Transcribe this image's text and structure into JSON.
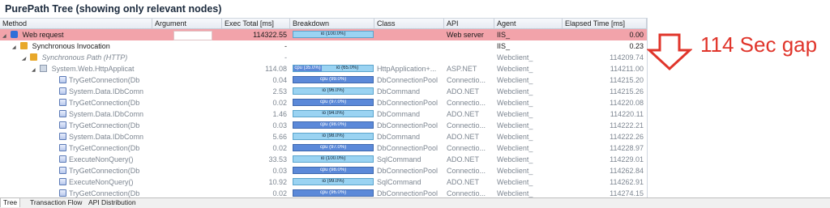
{
  "title": "PurePath Tree (showing only relevant nodes)",
  "columns": {
    "method": "Method",
    "argument": "Argument",
    "exec_total": "Exec Total [ms]",
    "breakdown": "Breakdown",
    "class": "Class",
    "api": "API",
    "agent": "Agent",
    "elapsed": "Elapsed Time [ms]"
  },
  "rows": [
    {
      "method": "Web request",
      "argument": "",
      "exec": "114322.55",
      "breakdown": "io (100.0%)",
      "class": "",
      "api": "Web server",
      "agent": "IIS_",
      "elapsed": "0.00"
    },
    {
      "method": "Synchronous Invocation",
      "argument": "",
      "exec": "-",
      "breakdown": "",
      "class": "",
      "api": "",
      "agent": "IIS_",
      "elapsed": "0.23"
    },
    {
      "method": "Synchronous Path (HTTP)",
      "argument": "",
      "exec": "-",
      "breakdown": "",
      "class": "",
      "api": "",
      "agent": "Webclient_",
      "elapsed": "114209.74"
    },
    {
      "method": "System.Web.HttpApplicat",
      "argument": "",
      "exec": "114.08",
      "breakdown_cpu": "cpu (35.0%)",
      "breakdown_io": "io (65.0%)",
      "class": "HttpApplication+...",
      "api": "ASP.NET",
      "agent": "Webclient_",
      "elapsed": "114211.00"
    },
    {
      "method": "TryGetConnection(Db",
      "argument": "",
      "exec": "0.04",
      "breakdown": "cpu (99.0%)",
      "class": "DbConnectionPool",
      "api": "Connectio...",
      "agent": "Webclient_",
      "elapsed": "114215.20"
    },
    {
      "method": "System.Data.IDbComn",
      "argument": "",
      "exec": "2.53",
      "breakdown": "io (96.0%)",
      "class": "DbCommand",
      "api": "ADO.NET",
      "agent": "Webclient_",
      "elapsed": "114215.26"
    },
    {
      "method": "TryGetConnection(Db",
      "argument": "",
      "exec": "0.02",
      "breakdown": "cpu (97.0%)",
      "class": "DbConnectionPool",
      "api": "Connectio...",
      "agent": "Webclient_",
      "elapsed": "114220.08"
    },
    {
      "method": "System.Data.IDbComn",
      "argument": "",
      "exec": "1.46",
      "breakdown": "io (94.0%)",
      "class": "DbCommand",
      "api": "ADO.NET",
      "agent": "Webclient_",
      "elapsed": "114220.11"
    },
    {
      "method": "TryGetConnection(Db",
      "argument": "",
      "exec": "0.03",
      "breakdown": "cpu (98.0%)",
      "class": "DbConnectionPool",
      "api": "Connectio...",
      "agent": "Webclient_",
      "elapsed": "114222.21"
    },
    {
      "method": "System.Data.IDbComn",
      "argument": "",
      "exec": "5.66",
      "breakdown": "io (98.0%)",
      "class": "DbCommand",
      "api": "ADO.NET",
      "agent": "Webclient_",
      "elapsed": "114222.26"
    },
    {
      "method": "TryGetConnection(Db",
      "argument": "",
      "exec": "0.02",
      "breakdown": "cpu (97.0%)",
      "class": "DbConnectionPool",
      "api": "Connectio...",
      "agent": "Webclient_",
      "elapsed": "114228.97"
    },
    {
      "method": "ExecuteNonQuery()",
      "argument": "",
      "exec": "33.53",
      "breakdown": "io (100.0%)",
      "class": "SqlCommand",
      "api": "ADO.NET",
      "agent": "Webclient_",
      "elapsed": "114229.01"
    },
    {
      "method": "TryGetConnection(Db",
      "argument": "",
      "exec": "0.03",
      "breakdown": "cpu (98.0%)",
      "class": "DbConnectionPool",
      "api": "Connectio...",
      "agent": "Webclient_",
      "elapsed": "114262.84"
    },
    {
      "method": "ExecuteNonQuery()",
      "argument": "",
      "exec": "10.92",
      "breakdown": "io (99.0%)",
      "class": "SqlCommand",
      "api": "ADO.NET",
      "agent": "Webclient_",
      "elapsed": "114262.91"
    },
    {
      "method": "TryGetConnection(Db",
      "argument": "",
      "exec": "0.02",
      "breakdown": "cpu (96.0%)",
      "class": "DbConnectionPool",
      "api": "Connectio...",
      "agent": "Webclient_",
      "elapsed": "114274.15"
    }
  ],
  "tabs": [
    "Tree",
    "Transaction Flow",
    "API Distribution"
  ],
  "annotation": "114 Sec gap",
  "colors": {
    "highlight": "#f2a3aa",
    "cpu": "#5b89d9",
    "io": "#9ad3f2",
    "annotation": "#e0352b"
  },
  "icons": {
    "web_request": "globe-icon",
    "sync": "sync-icon",
    "method": "method-icon",
    "db": "database-icon"
  }
}
